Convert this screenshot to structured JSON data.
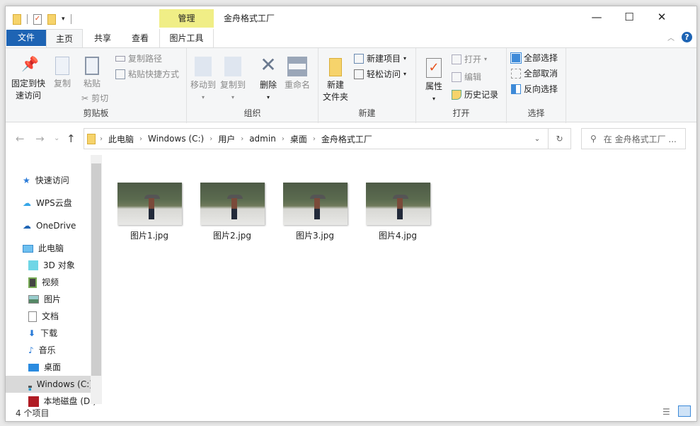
{
  "title_bar": {
    "title": "金舟格式工厂",
    "context_tab": "管理",
    "controls": {
      "minimize": "—",
      "maximize": "☐",
      "close": "✕"
    }
  },
  "tabs": [
    {
      "label": "文件"
    },
    {
      "label": "主页"
    },
    {
      "label": "共享"
    },
    {
      "label": "查看"
    },
    {
      "label": "图片工具"
    }
  ],
  "ribbon": {
    "clipboard": {
      "label": "剪贴板",
      "pin": "固定到快速访问",
      "pin1": "固定到快",
      "pin2": "速访问",
      "copy": "复制",
      "paste": "粘贴",
      "copy_path": "复制路径",
      "paste_shortcut": "粘贴快捷方式",
      "cut": "剪切"
    },
    "organize": {
      "label": "组织",
      "move_to": "移动到",
      "copy_to": "复制到",
      "delete": "删除",
      "rename": "重命名"
    },
    "new": {
      "label": "新建",
      "new_folder1": "新建",
      "new_folder2": "文件夹",
      "new_item": "新建项目",
      "easy_access": "轻松访问"
    },
    "open": {
      "label": "打开",
      "properties": "属性",
      "open": "打开",
      "edit": "编辑",
      "history": "历史记录"
    },
    "select": {
      "label": "选择",
      "select_all": "全部选择",
      "select_none": "全部取消",
      "invert": "反向选择"
    }
  },
  "address": {
    "crumbs": [
      "此电脑",
      "Windows (C:)",
      "用户",
      "admin",
      "桌面",
      "金舟格式工厂"
    ]
  },
  "search": {
    "placeholder": "在 金舟格式工厂 ..."
  },
  "sidebar": {
    "items": [
      {
        "label": "快速访问",
        "icon": "star-icon"
      },
      {
        "label": "WPS云盘",
        "icon": "cloud-icon"
      },
      {
        "label": "OneDrive",
        "icon": "onedrive-icon"
      },
      {
        "label": "此电脑",
        "icon": "computer-icon"
      },
      {
        "label": "3D 对象",
        "icon": "cube-icon"
      },
      {
        "label": "视频",
        "icon": "video-icon"
      },
      {
        "label": "图片",
        "icon": "picture-icon"
      },
      {
        "label": "文档",
        "icon": "document-icon"
      },
      {
        "label": "下载",
        "icon": "download-icon"
      },
      {
        "label": "音乐",
        "icon": "music-icon"
      },
      {
        "label": "桌面",
        "icon": "desktop-icon"
      },
      {
        "label": "Windows (C:)",
        "icon": "drive-icon"
      },
      {
        "label": "本地磁盘 (D:)",
        "icon": "disk-icon"
      }
    ]
  },
  "files": [
    {
      "name": "图片1.jpg"
    },
    {
      "name": "图片2.jpg"
    },
    {
      "name": "图片3.jpg"
    },
    {
      "name": "图片4.jpg"
    }
  ],
  "status": {
    "count": "4 个项目"
  },
  "colors": {
    "file_tab": "#1e64b4",
    "manage_tab": "#f0ee86",
    "selected_item": "#d9d9d9"
  }
}
